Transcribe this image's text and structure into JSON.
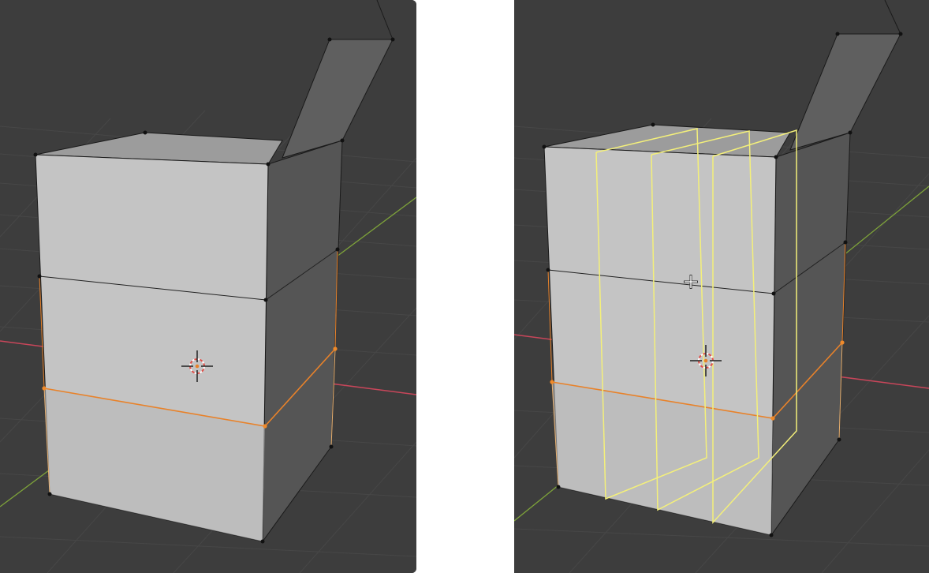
{
  "viewports": [
    {
      "id": "left",
      "mode": "edit-mode-selected-edge-loop",
      "selected_edge_color": "#e8822a"
    },
    {
      "id": "right",
      "mode": "edit-mode-loop-cut-preview",
      "selected_edge_color": "#e8822a",
      "loop_cut_preview_color": "#f4f07a",
      "loop_cut_count": 3
    }
  ],
  "colors": {
    "viewport_bg": "#3d3d3d",
    "grid": "#4a4a4a",
    "x_axis": "#c8465a",
    "y_axis": "#7ea33a",
    "front_face": "#c3c3c3",
    "side_face": "#555555",
    "top_face": "#9a9a9a",
    "flap_face": "#5d5d5d",
    "vertex": "#111111"
  },
  "icons": [
    "3d-cursor-icon",
    "mouse-crosshair-icon"
  ]
}
